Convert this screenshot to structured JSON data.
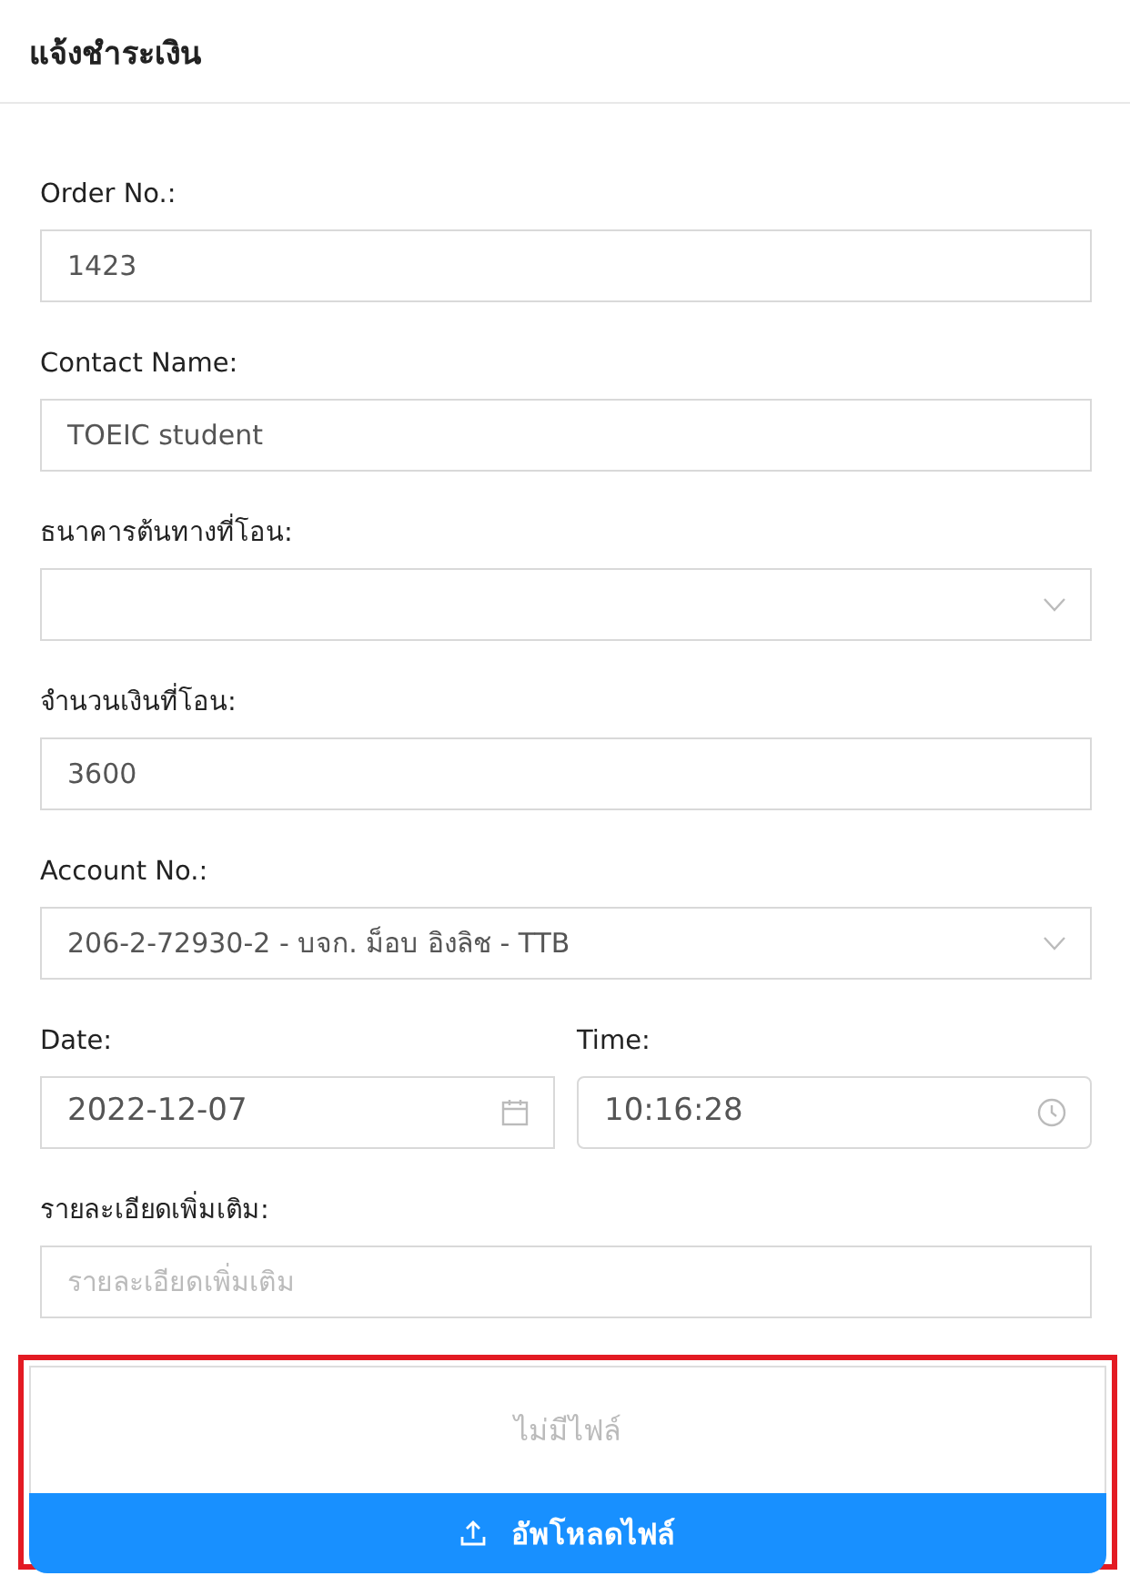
{
  "header": {
    "title": "แจ้งชำระเงิน"
  },
  "fields": [
    {
      "kind": "text",
      "label": "Order No.:",
      "value": "1423"
    },
    {
      "kind": "text",
      "label": "Contact Name:",
      "value": "TOEIC student"
    },
    {
      "kind": "select",
      "label": "ธนาคารต้นทางที่โอน:"
    },
    {
      "kind": "text",
      "label": "จำนวนเงินที่โอน:",
      "value": "3600"
    },
    {
      "kind": "select",
      "label": "Account No.:",
      "value": "206-2-72930-2 - บจก. ม็อบ อิงลิช - TTB"
    },
    {
      "kind": "date",
      "label": "Date:",
      "value": "2022-12-07"
    },
    {
      "kind": "time",
      "label": "Time:",
      "value": "10:16:28"
    },
    {
      "kind": "text",
      "label": "รายละเอียดเพิ่มเติม:",
      "placeholder": "รายละเอียดเพิ่มเติม"
    }
  ],
  "upload": {
    "status": "ไม่มีไฟล์",
    "button": "อัพโหลดไฟล์"
  }
}
